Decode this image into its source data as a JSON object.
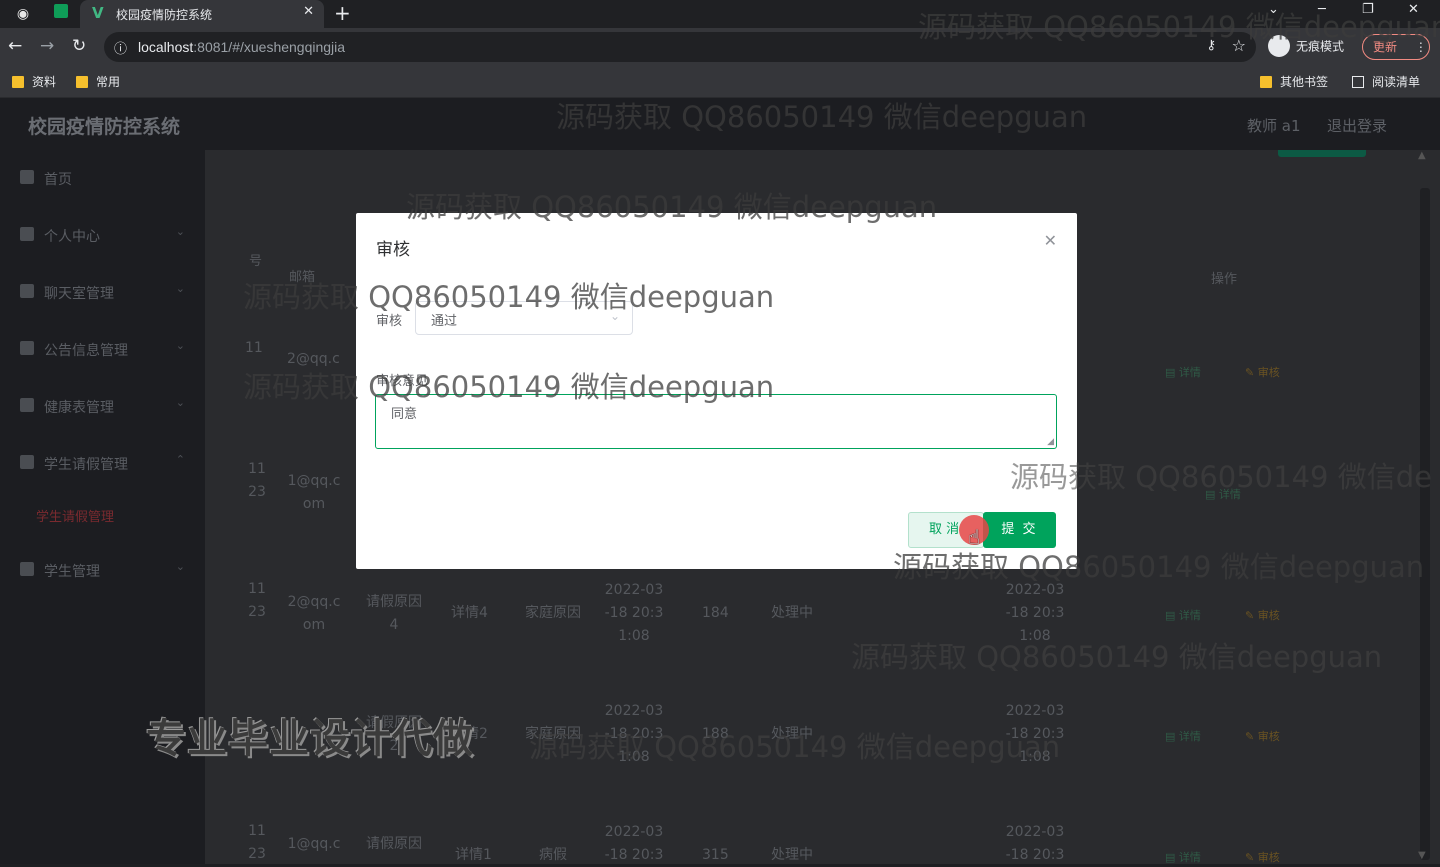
{
  "browser": {
    "tab_title": "校园疫情防控系统",
    "url_host": "localhost",
    "url_rest": ":8081/#/xueshengqingjia",
    "incognito_label": "无痕模式",
    "update_label": "更新",
    "bookmarks": [
      "资料",
      "常用"
    ],
    "bookmarks_right": [
      "其他书签",
      "阅读清单"
    ]
  },
  "app": {
    "title": "校园疫情防控系统",
    "user_label": "教师 a1",
    "logout_label": "退出登录"
  },
  "sidebar": {
    "items": [
      {
        "label": "首页",
        "icon": "home-icon"
      },
      {
        "label": "个人中心",
        "icon": "user-icon"
      },
      {
        "label": "聊天室管理",
        "icon": "chat-icon"
      },
      {
        "label": "公告信息管理",
        "icon": "notice-icon"
      },
      {
        "label": "健康表管理",
        "icon": "health-icon"
      },
      {
        "label": "学生请假管理",
        "icon": "flag-icon"
      },
      {
        "label": "学生管理",
        "icon": "student-icon"
      }
    ],
    "active_sub": "学生请假管理"
  },
  "table": {
    "col_index_fragment": "号",
    "col_email": "邮箱",
    "col_action": "操作",
    "action_detail": "详情",
    "action_review": "审核",
    "rows": [
      {
        "id_a": "11",
        "id_b": "",
        "email_a": "2@qq.c",
        "email_b": "",
        "reason_a": "",
        "reason_b": "",
        "detail": "",
        "type": "",
        "time_a": "",
        "time_b": "",
        "time_c": "",
        "days": "",
        "status": "",
        "t2_a": "",
        "t2_b": "",
        "t2_c": ""
      },
      {
        "id_a": "11",
        "id_b": "23",
        "email_a": "1@qq.c",
        "email_b": "om",
        "reason_a": "",
        "reason_b": "",
        "detail": "",
        "type": "",
        "time_a": "",
        "time_b": "",
        "time_c": "",
        "days": "",
        "status": "",
        "t2_a": "",
        "t2_b": "",
        "t2_c": ""
      },
      {
        "id_a": "11",
        "id_b": "23",
        "email_a": "2@qq.c",
        "email_b": "om",
        "reason_a": "请假原因",
        "reason_b": "4",
        "detail": "详情4",
        "type": "家庭原因",
        "time_a": "2022-03",
        "time_b": "-18 20:3",
        "time_c": "1:08",
        "days": "184",
        "status": "处理中",
        "t2_a": "2022-03",
        "t2_b": "-18 20:3",
        "t2_c": "1:08"
      },
      {
        "id_a": "",
        "id_b": "",
        "email_a": "",
        "email_b": "",
        "reason_a": "请假原因",
        "reason_b": "2",
        "detail": "详情2",
        "type": "家庭原因",
        "time_a": "2022-03",
        "time_b": "-18 20:3",
        "time_c": "1:08",
        "days": "188",
        "status": "处理中",
        "t2_a": "2022-03",
        "t2_b": "-18 20:3",
        "t2_c": "1:08"
      },
      {
        "id_a": "11",
        "id_b": "23",
        "email_a": "1@qq.c",
        "email_b": "",
        "reason_a": "请假原因",
        "reason_b": "",
        "detail": "详情1",
        "type": "病假",
        "time_a": "2022-03",
        "time_b": "-18 20:3",
        "time_c": "",
        "days": "315",
        "status": "处理中",
        "t2_a": "2022-03",
        "t2_b": "-18 20:3",
        "t2_c": ""
      }
    ]
  },
  "dialog": {
    "title": "审核",
    "review_label": "审核",
    "review_value": "通过",
    "opinion_label": "审核意见",
    "opinion_value": "同意",
    "cancel_label": "取 消",
    "submit_label": "提 交"
  },
  "watermarks": {
    "text": "源码获取 QQ86050149 微信deepguan",
    "text_cut_1": "源码获取 QQ86050149 微信deepguan",
    "text_cut_2": "源码获取 QQ86050149 微信de",
    "promo": "专业毕业设计代做"
  }
}
